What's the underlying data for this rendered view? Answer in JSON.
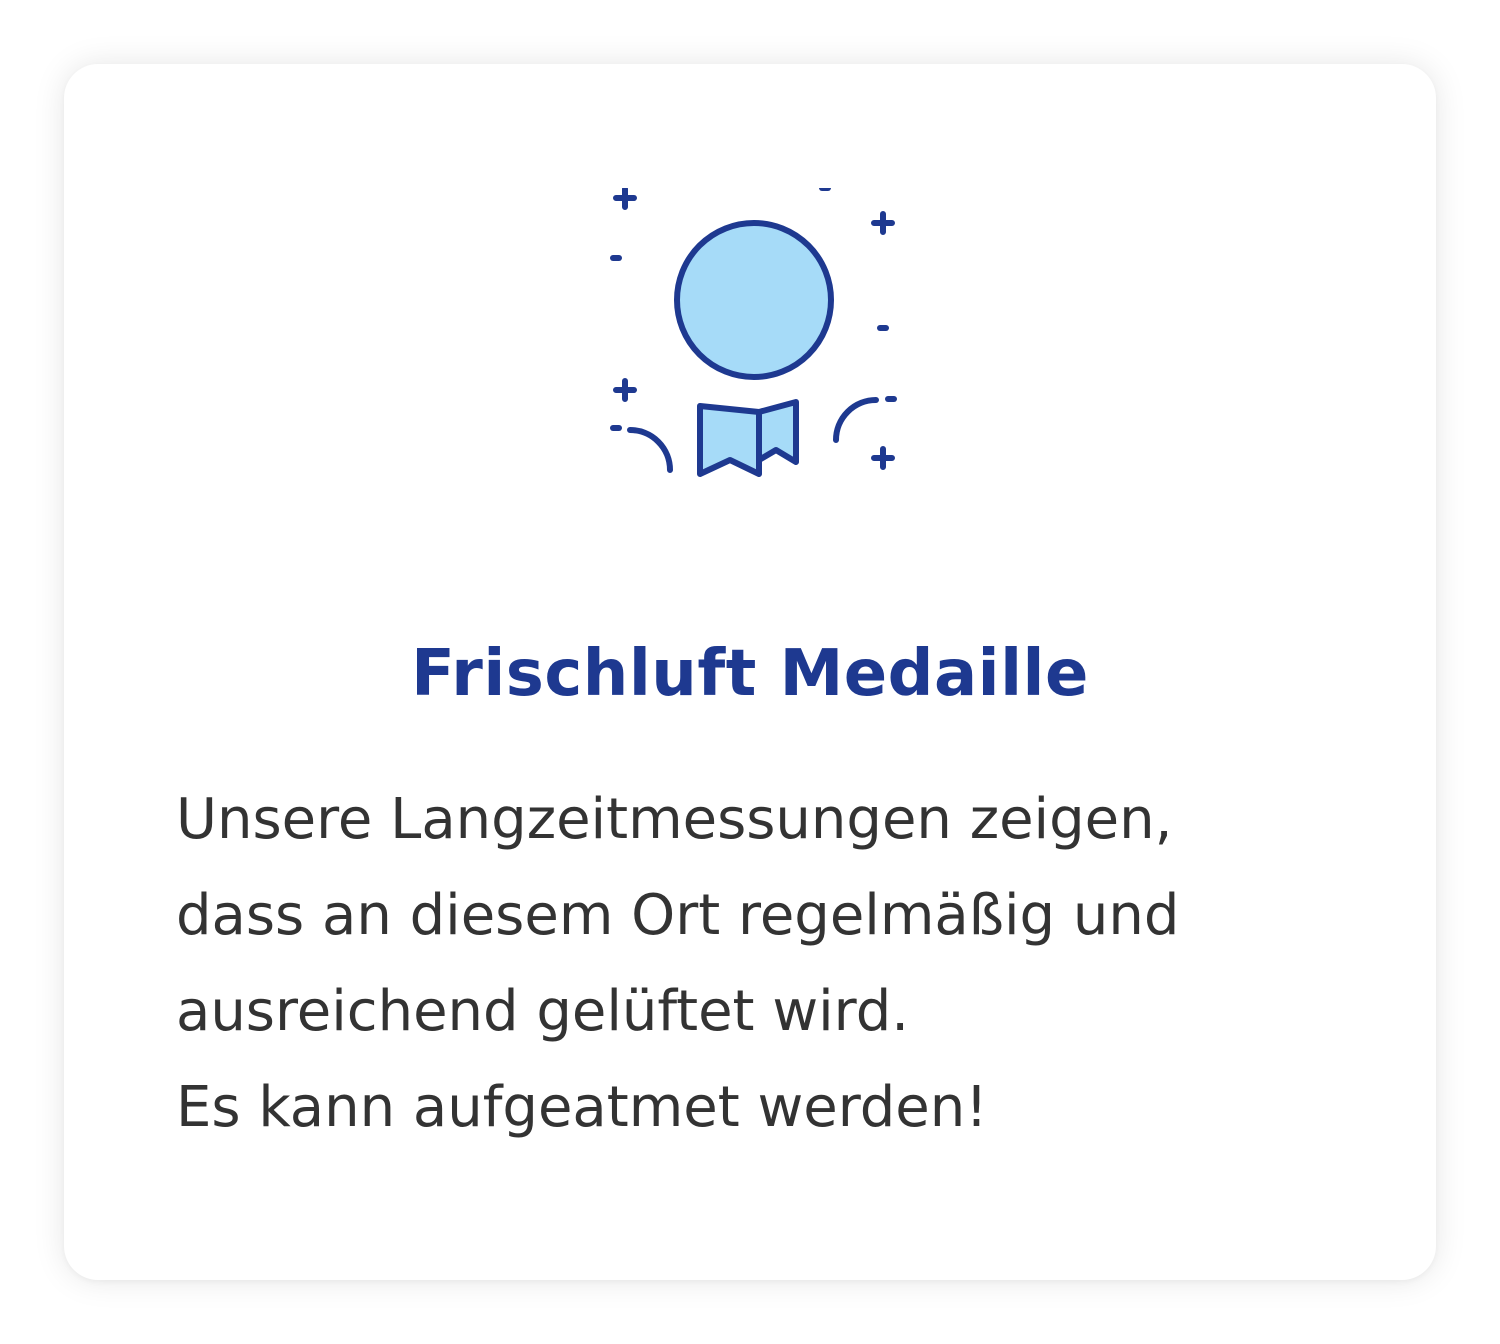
{
  "card": {
    "icon": "medal-award-icon",
    "title": "Frischluft Medaille",
    "lines": [
      "Unsere Langzeitmessungen zeigen,",
      "dass an diesem Ort regelmäßig und",
      "ausreichend gelüftet wird.",
      "Es kann aufgeatmet werden!"
    ]
  },
  "colors": {
    "accent": "#1e3990",
    "medal_fill": "#a6dbf8",
    "text": "#333333",
    "background": "#ffffff"
  }
}
